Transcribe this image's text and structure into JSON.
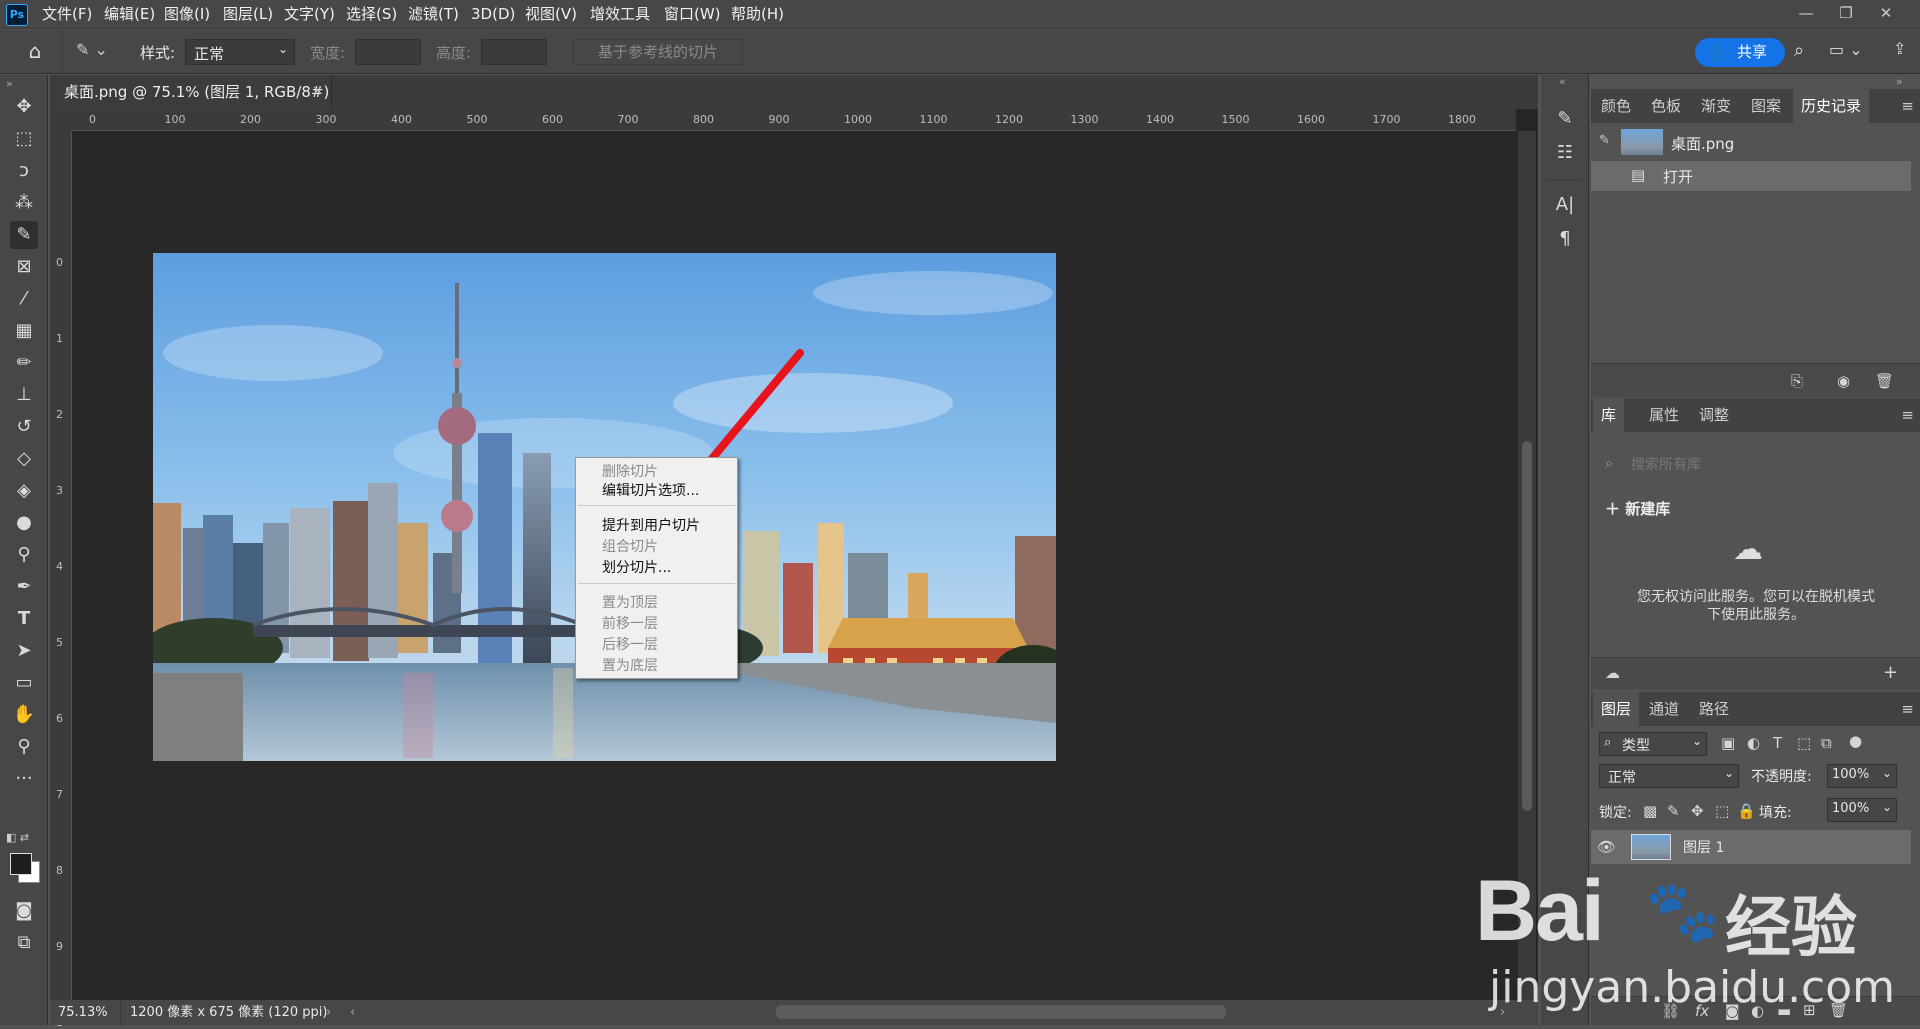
{
  "menubar": {
    "logo": "Ps",
    "items": [
      "文件(F)",
      "编辑(E)",
      "图像(I)",
      "图层(L)",
      "文字(Y)",
      "选择(S)",
      "滤镜(T)",
      "3D(D)",
      "视图(V)",
      "增效工具",
      "窗口(W)",
      "帮助(H)"
    ]
  },
  "options": {
    "style_label": "样式:",
    "style_value": "正常",
    "width_label": "宽度:",
    "height_label": "高度:",
    "guides_button": "基于参考线的切片",
    "share_label": "共享"
  },
  "document": {
    "tab_title": "桌面.png @ 75.1% (图层 1, RGB/8#)",
    "ruler_top": [
      "0",
      "100",
      "200",
      "300",
      "400",
      "500",
      "600",
      "700",
      "800",
      "900",
      "1000",
      "1100",
      "1200",
      "1300",
      "1400",
      "1500",
      "1600",
      "1700",
      "1800"
    ],
    "ruler_left": [
      "0",
      "1",
      "2",
      "3",
      "4",
      "5",
      "6",
      "7",
      "8",
      "9",
      "1"
    ]
  },
  "context_menu": {
    "items": [
      {
        "label": "删除切片",
        "enabled": false
      },
      {
        "label": "编辑切片选项...",
        "enabled": true
      },
      {
        "label": "提升到用户切片",
        "enabled": true
      },
      {
        "label": "组合切片",
        "enabled": false
      },
      {
        "label": "划分切片...",
        "enabled": true
      },
      {
        "label": "置为顶层",
        "enabled": false
      },
      {
        "label": "前移一层",
        "enabled": false
      },
      {
        "label": "后移一层",
        "enabled": false
      },
      {
        "label": "置为底层",
        "enabled": false
      }
    ]
  },
  "status": {
    "zoom": "75.13%",
    "info": "1200 像素 x 675 像素 (120 ppi)"
  },
  "history_panel": {
    "tabs": [
      "颜色",
      "色板",
      "渐变",
      "图案",
      "历史记录"
    ],
    "active_tab": "历史记录",
    "snapshot": "桌面.png",
    "states": [
      "打开"
    ]
  },
  "library_panel": {
    "tabs": [
      "库",
      "属性",
      "调整"
    ],
    "search_placeholder": "搜索所有库",
    "new_library": "新建库",
    "message": "您无权访问此服务。您可以在脱机模式下使用此服务。"
  },
  "layers_panel": {
    "tabs": [
      "图层",
      "通道",
      "路径"
    ],
    "filter": "类型",
    "blend_mode": "正常",
    "opacity_label": "不透明度:",
    "opacity": "100%",
    "lock_label": "锁定:",
    "fill_label": "填充:",
    "fill": "100%",
    "layers": [
      "图层 1"
    ]
  },
  "watermark": {
    "brand": "Bai",
    "brand2": "经验",
    "url": "jingyan.baidu.com"
  },
  "colors": {
    "accent": "#1473e6",
    "arrow": "#e8141b"
  }
}
